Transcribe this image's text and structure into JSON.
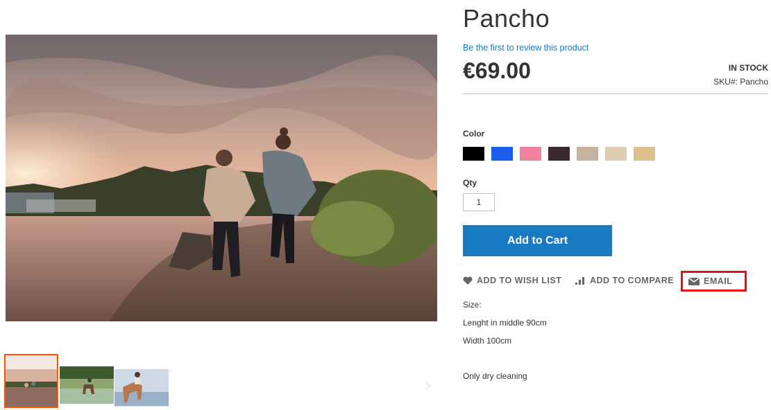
{
  "product": {
    "title": "Pancho",
    "review_link": "Be the first to review this product",
    "price": "€69.00",
    "stock_status": "In stock",
    "sku_label": "SKU#:",
    "sku_value": "Pancho"
  },
  "options": {
    "color_label": "Color",
    "swatches": [
      {
        "name": "black",
        "color": "#000000"
      },
      {
        "name": "blue",
        "color": "#1b5ced"
      },
      {
        "name": "pink",
        "color": "#ee829f"
      },
      {
        "name": "dark-brown",
        "color": "#3a2a2e"
      },
      {
        "name": "taupe",
        "color": "#c4b39d"
      },
      {
        "name": "beige",
        "color": "#dcceb2"
      },
      {
        "name": "sand",
        "color": "#dcc18f"
      }
    ],
    "qty_label": "Qty",
    "qty_value": "1"
  },
  "actions": {
    "add_to_cart": "Add to Cart",
    "wishlist": "Add to Wish List",
    "compare": "Add to Compare",
    "email": "Email"
  },
  "description": {
    "lines": [
      "Size:",
      "Lenght in middle 90cm",
      "Width 100cm",
      "Only dry cleaning"
    ]
  },
  "gallery": {
    "next_arrow": "›"
  },
  "colors": {
    "link": "#1979c3",
    "button": "#1979c3",
    "active_thumb": "#ff5501",
    "highlight": "#e3101b"
  }
}
